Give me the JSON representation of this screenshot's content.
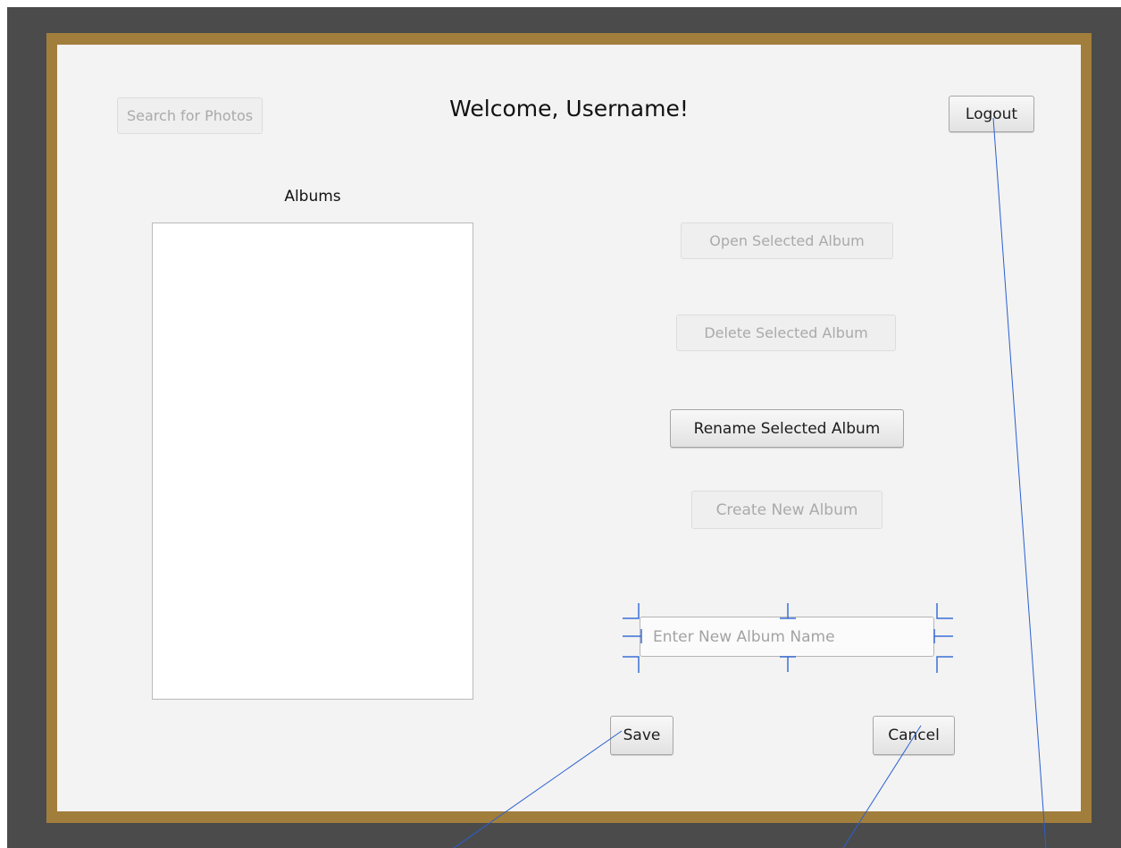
{
  "window": {
    "title": "Welcome, Username!"
  },
  "toolbar": {
    "search_label": "Search for Photos",
    "logout_label": "Logout"
  },
  "albums": {
    "heading": "Albums",
    "items": []
  },
  "actions": {
    "open_label": "Open Selected Album",
    "delete_label": "Delete Selected Album",
    "rename_label": "Rename Selected Album",
    "create_label": "Create New Album"
  },
  "new_album": {
    "value": "",
    "placeholder": "Enter New Album Name"
  },
  "footer": {
    "save_label": "Save",
    "cancel_label": "Cancel"
  },
  "colors": {
    "frame": "#a27e3c",
    "background": "#4b4b4b",
    "window": "#f3f3f3",
    "annotation": "#2a5fd0"
  }
}
